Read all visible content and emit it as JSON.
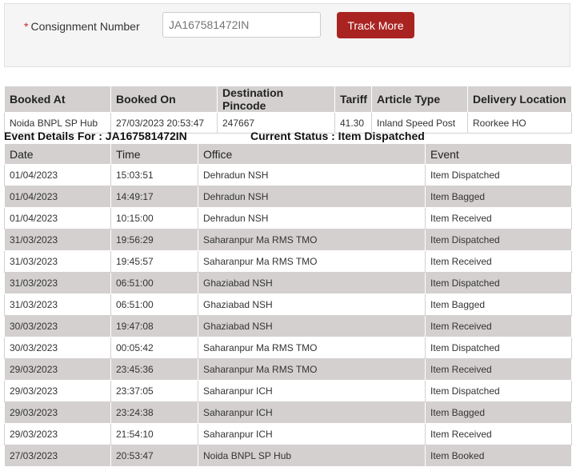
{
  "form": {
    "required_mark": "*",
    "label": "Consignment Number",
    "input_value": "JA167581472IN",
    "track_button": "Track More"
  },
  "booking": {
    "headers": [
      "Booked At",
      "Booked On",
      "Destination Pincode",
      "Tariff",
      "Article Type",
      "Delivery Location"
    ],
    "row": [
      "Noida BNPL SP Hub",
      "27/03/2023 20:53:47",
      "247667",
      "41.30",
      "Inland Speed Post",
      "Roorkee HO"
    ]
  },
  "event_details": {
    "title": "Event Details For : JA167581472IN",
    "status": "Current Status : Item Dispatched"
  },
  "events": {
    "headers": [
      "Date",
      "Time",
      "Office",
      "Event"
    ],
    "rows": [
      [
        "01/04/2023",
        "15:03:51",
        "Dehradun NSH",
        "Item Dispatched"
      ],
      [
        "01/04/2023",
        "14:49:17",
        "Dehradun NSH",
        "Item Bagged"
      ],
      [
        "01/04/2023",
        "10:15:00",
        "Dehradun NSH",
        "Item Received"
      ],
      [
        "31/03/2023",
        "19:56:29",
        "Saharanpur Ma RMS TMO",
        "Item Dispatched"
      ],
      [
        "31/03/2023",
        "19:45:57",
        "Saharanpur Ma RMS TMO",
        "Item Received"
      ],
      [
        "31/03/2023",
        "06:51:00",
        "Ghaziabad NSH",
        "Item Dispatched"
      ],
      [
        "31/03/2023",
        "06:51:00",
        "Ghaziabad NSH",
        "Item Bagged"
      ],
      [
        "30/03/2023",
        "19:47:08",
        "Ghaziabad NSH",
        "Item Received"
      ],
      [
        "30/03/2023",
        "00:05:42",
        "Saharanpur Ma RMS TMO",
        "Item Dispatched"
      ],
      [
        "29/03/2023",
        "23:45:36",
        "Saharanpur Ma RMS TMO",
        "Item Received"
      ],
      [
        "29/03/2023",
        "23:37:05",
        "Saharanpur ICH",
        "Item Dispatched"
      ],
      [
        "29/03/2023",
        "23:24:38",
        "Saharanpur ICH",
        "Item Bagged"
      ],
      [
        "29/03/2023",
        "21:54:10",
        "Saharanpur ICH",
        "Item Received"
      ],
      [
        "27/03/2023",
        "20:53:47",
        "Noida BNPL SP Hub",
        "Item Booked"
      ]
    ]
  },
  "colors": {
    "button": "#a92421",
    "header_bg": "#d4d0d0",
    "required_mark": "#c62828"
  }
}
